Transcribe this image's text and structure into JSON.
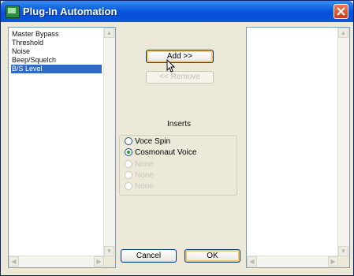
{
  "window": {
    "title": "Plug-In Automation"
  },
  "left_list": {
    "items": [
      {
        "label": "Master Bypass",
        "selected": false
      },
      {
        "label": "Threshold",
        "selected": false
      },
      {
        "label": "Noise",
        "selected": false
      },
      {
        "label": "Beep/Squelch",
        "selected": false
      },
      {
        "label": "B/S Level",
        "selected": true
      }
    ]
  },
  "buttons": {
    "add": "Add >>",
    "remove": "<< Remove",
    "cancel": "Cancel",
    "ok": "OK"
  },
  "inserts": {
    "label": "Inserts",
    "options": [
      {
        "label": "Voce Spin",
        "checked": false,
        "enabled": true
      },
      {
        "label": "Cosmonaut Voice",
        "checked": true,
        "enabled": true
      },
      {
        "label": "None",
        "checked": false,
        "enabled": false
      },
      {
        "label": "None",
        "checked": false,
        "enabled": false
      },
      {
        "label": "None",
        "checked": false,
        "enabled": false
      }
    ]
  },
  "right_list": {
    "items": []
  },
  "colors": {
    "titlebar": "#0a5adf",
    "selection": "#316ac5",
    "dialog_bg": "#ece9d8"
  }
}
